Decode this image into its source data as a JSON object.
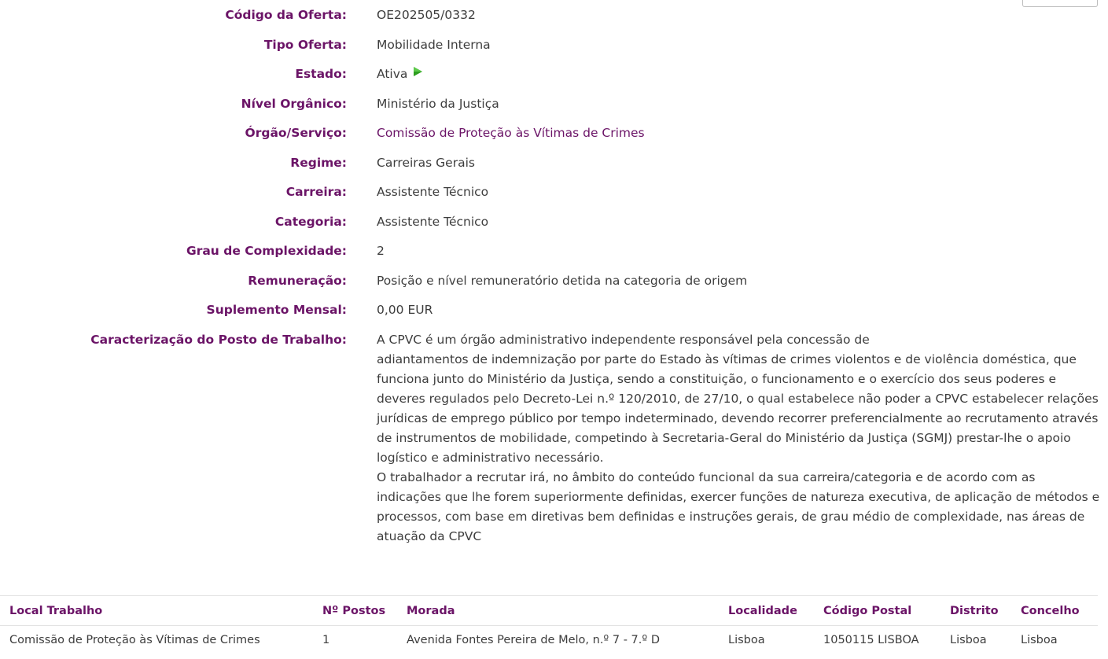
{
  "details": {
    "codigo": {
      "label": "Código da Oferta:",
      "value": "OE202505/0332"
    },
    "tipo": {
      "label": "Tipo Oferta:",
      "value": "Mobilidade Interna"
    },
    "estado": {
      "label": "Estado:",
      "value": "Ativa",
      "icon": "play-icon"
    },
    "nivel": {
      "label": "Nível Orgânico:",
      "value": "Ministério da Justiça"
    },
    "orgao": {
      "label": "Órgão/Serviço:",
      "value": "Comissão de Proteção às Vítimas de Crimes"
    },
    "regime": {
      "label": "Regime:",
      "value": "Carreiras Gerais"
    },
    "carreira": {
      "label": "Carreira:",
      "value": "Assistente Técnico"
    },
    "categoria": {
      "label": "Categoria:",
      "value": "Assistente Técnico"
    },
    "grau": {
      "label": "Grau de Complexidade:",
      "value": "2"
    },
    "remuneracao": {
      "label": "Remuneração:",
      "value": "Posição e nível remuneratório detida na categoria de origem"
    },
    "suplemento": {
      "label": "Suplemento Mensal:",
      "value": "0,00 EUR"
    },
    "caracterizacao": {
      "label": "Caracterização do Posto de Trabalho:",
      "value": "A CPVC é um órgão administrativo independente responsável pela concessão de\nadiantamentos de indemnização por parte do Estado às vítimas de crimes violentos e de violência doméstica, que funciona junto do Ministério da Justiça, sendo a constituição, o funcionamento e o exercício dos seus poderes e deveres regulados pelo Decreto-Lei n.º 120/2010, de 27/10, o qual estabelece não poder a CPVC estabelecer relações jurídicas de emprego público por tempo indeterminado, devendo recorrer preferencialmente ao recrutamento através de instrumentos de mobilidade, competindo à Secretaria-Geral do Ministério da Justiça (SGMJ) prestar-lhe o apoio logístico e administrativo necessário.\nO trabalhador a recrutar irá, no âmbito do conteúdo funcional da sua carreira/categoria e de acordo com as indicações que lhe forem superiormente definidas, exercer funções de natureza executiva, de aplicação de métodos e processos, com base em diretivas bem definidas e instruções gerais, de grau médio de complexidade, nas áreas de atuação da CPVC"
    }
  },
  "table": {
    "headers": [
      "Local Trabalho",
      "Nº Postos",
      "Morada",
      "Localidade",
      "Código Postal",
      "Distrito",
      "Concelho"
    ],
    "rows": [
      [
        "Comissão de Proteção às Vítimas de Crimes",
        "1",
        "Avenida Fontes Pereira de Melo, n.º 7 - 7.º D",
        "Lisboa",
        "1050115 LISBOA",
        "Lisboa",
        "Lisboa"
      ]
    ]
  },
  "colors": {
    "accent": "#6b1467",
    "icon_green": "#2e9e1f"
  }
}
